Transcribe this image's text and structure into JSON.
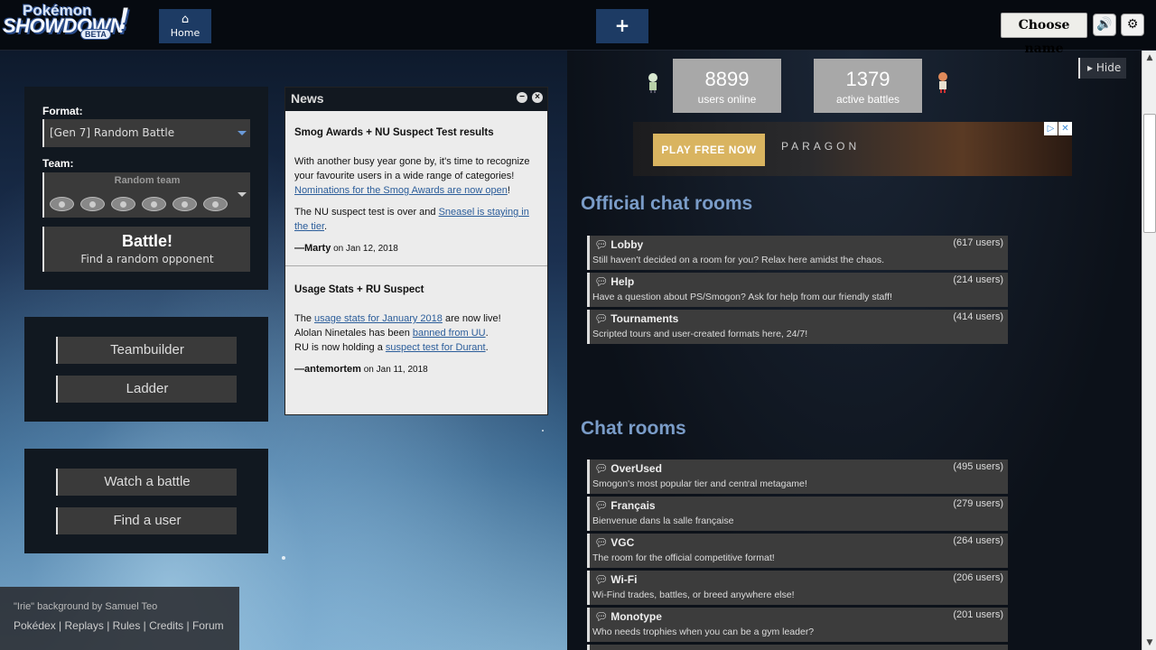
{
  "header": {
    "logo": {
      "line1": "Pokémon",
      "line2": "SHOWDOWN",
      "badge": "BETA"
    },
    "home_icon": "home-icon",
    "home_label": "Home",
    "new_tab_label": "+",
    "choose_name": "Choose name",
    "sound_icon": "speaker-icon",
    "settings_icon": "gear-icon"
  },
  "battle_form": {
    "format_label": "Format:",
    "format_value": "[Gen 7] Random Battle",
    "team_label": "Team:",
    "team_value": "Random team",
    "battle_label": "Battle!",
    "battle_sublabel": "Find a random opponent"
  },
  "menu": {
    "teambuilder": "Teambuilder",
    "ladder": "Ladder",
    "watch": "Watch a battle",
    "find_user": "Find a user"
  },
  "news": {
    "title": "News",
    "items": [
      {
        "title": "Smog Awards + NU Suspect Test results",
        "p1_pre": "With another busy year gone by, it's time to recognize your favourite users in a wide range of categories! ",
        "p1_link": "Nominations for the Smog Awards are now open",
        "p1_post": "!",
        "p2_pre": "The NU suspect test is over and ",
        "p2_link": "Sneasel is staying in the tier",
        "p2_post": ".",
        "author": "—Marty",
        "date": " on Jan 12, 2018"
      },
      {
        "title": "Usage Stats + RU Suspect",
        "l1_pre": "The ",
        "l1_link": "usage stats for January 2018",
        "l1_post": " are now live!",
        "l2_pre": "Alolan Ninetales has been ",
        "l2_link": "banned from UU",
        "l2_post": ".",
        "l3_pre": "RU is now holding a ",
        "l3_link": "suspect test for Durant",
        "l3_post": ".",
        "author": "—antemortem",
        "date": " on Jan 11, 2018"
      }
    ]
  },
  "footer": {
    "credit": "\"Irie\" background by Samuel Teo",
    "links": [
      "Pokédex",
      "Replays",
      "Rules",
      "Credits",
      "Forum"
    ],
    "separator": " | "
  },
  "stats": {
    "users_online": "8899",
    "users_online_label": "users online",
    "active_battles": "1379",
    "active_battles_label": "active battles"
  },
  "hide_label": "Hide",
  "ad": {
    "play": "PLAY FREE NOW",
    "brand": "PARAGON"
  },
  "official_rooms_title": "Official chat rooms",
  "official_rooms": [
    {
      "name": "Lobby",
      "users": "(617 users)",
      "desc": "Still haven't decided on a room for you? Relax here amidst the chaos."
    },
    {
      "name": "Help",
      "users": "(214 users)",
      "desc": "Have a question about PS/Smogon? Ask for help from our friendly staff!"
    },
    {
      "name": "Tournaments",
      "users": "(414 users)",
      "desc": "Scripted tours and user-created formats here, 24/7!"
    }
  ],
  "chat_rooms_title": "Chat rooms",
  "chat_rooms": [
    {
      "name": "OverUsed",
      "users": "(495 users)",
      "desc": "Smogon's most popular tier and central metagame!"
    },
    {
      "name": "Français",
      "users": "(279 users)",
      "desc": "Bienvenue dans la salle française"
    },
    {
      "name": "VGC",
      "users": "(264 users)",
      "desc": "The room for the official competitive format!"
    },
    {
      "name": "Wi-Fi",
      "users": "(206 users)",
      "desc": "Wi-Find trades, battles, or breed anywhere else!"
    },
    {
      "name": "Monotype",
      "users": "(201 users)",
      "desc": "Who needs trophies when you can be a gym leader?"
    }
  ]
}
